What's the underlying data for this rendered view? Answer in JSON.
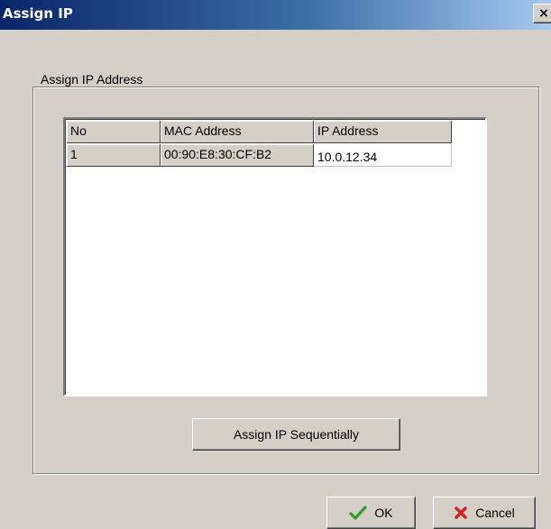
{
  "window": {
    "title": "Assign IP",
    "close_glyph": "×"
  },
  "group": {
    "legend": "Assign IP Address"
  },
  "grid": {
    "columns": [
      "No",
      "MAC Address",
      "IP Address"
    ],
    "rows": [
      {
        "no": "1",
        "mac": "00:90:E8:30:CF:B2",
        "ip": "10.0.12.34"
      }
    ]
  },
  "buttons": {
    "assign_sequentially": "Assign IP Sequentially",
    "ok": "OK",
    "cancel": "Cancel"
  },
  "icons": {
    "ok": "checkmark-icon",
    "cancel": "red-x-icon"
  },
  "colors": {
    "title_gradient_start": "#0a246a",
    "title_gradient_end": "#a6caf0",
    "dialog_bg": "#d4d0c8",
    "ok_icon": "#2e9e2e",
    "cancel_icon": "#d22020"
  }
}
